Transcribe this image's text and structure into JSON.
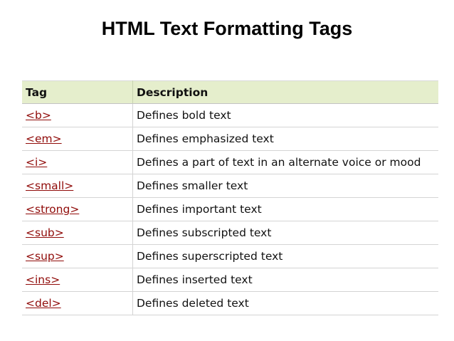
{
  "title": "HTML Text Formatting Tags",
  "table": {
    "headers": {
      "tag": "Tag",
      "description": "Description"
    },
    "rows": [
      {
        "tag": "<b>",
        "description": "Defines bold text"
      },
      {
        "tag": "<em>",
        "description": "Defines emphasized text"
      },
      {
        "tag": "<i>",
        "description": "Defines a part of text in an alternate voice or mood"
      },
      {
        "tag": "<small>",
        "description": "Defines smaller text"
      },
      {
        "tag": "<strong>",
        "description": "Defines important text"
      },
      {
        "tag": "<sub>",
        "description": "Defines subscripted text"
      },
      {
        "tag": "<sup>",
        "description": "Defines superscripted text"
      },
      {
        "tag": "<ins>",
        "description": "Defines inserted text"
      },
      {
        "tag": "<del>",
        "description": "Defines deleted text"
      }
    ]
  },
  "colors": {
    "header_bg": "#e5eecc",
    "link": "#900b09",
    "border": "#d4d4d4"
  }
}
